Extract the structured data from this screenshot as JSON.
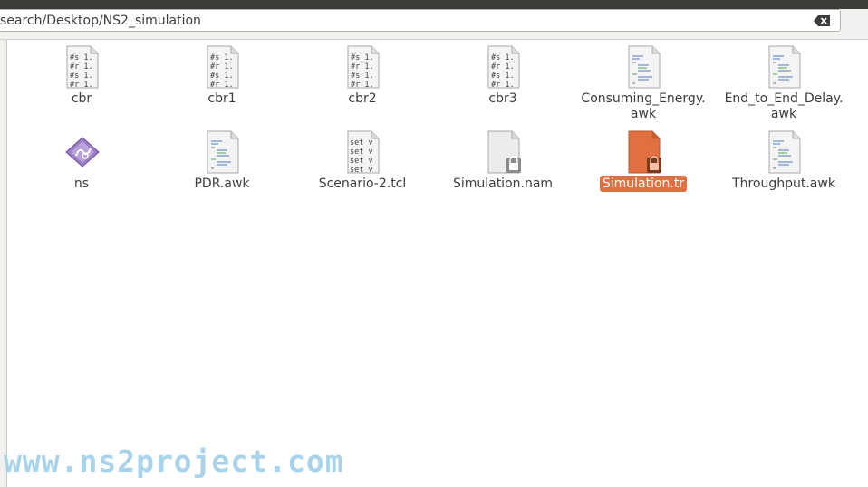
{
  "location_bar": {
    "path": "search/Desktop/NS2_simulation"
  },
  "files": [
    {
      "name": "cbr",
      "type": "text-preview",
      "preview": [
        "#s 1.",
        "#r 1.",
        "#s 1.",
        "#r 1."
      ]
    },
    {
      "name": "cbr1",
      "type": "text-preview",
      "preview": [
        "#s 1.",
        "#r 1.",
        "#s 1.",
        "#r 1."
      ]
    },
    {
      "name": "cbr2",
      "type": "text-preview",
      "preview": [
        "#s 1.",
        "#r 1.",
        "#s 1.",
        "#r 1."
      ]
    },
    {
      "name": "cbr3",
      "type": "text-preview",
      "preview": [
        "#s 1.",
        "#r 1.",
        "#s 1.",
        "#r 1."
      ]
    },
    {
      "name_line1": "Consuming_Energy.",
      "name_line2": "awk",
      "type": "code-lines"
    },
    {
      "name_line1": "End_to_End_Delay.",
      "name_line2": "awk",
      "type": "code-lines"
    },
    {
      "name": "ns",
      "type": "executable"
    },
    {
      "name": "PDR.awk",
      "type": "code-lines"
    },
    {
      "name": "Scenario-2.tcl",
      "type": "text-preview",
      "preview": [
        "set v",
        "set v",
        "set v",
        "set v"
      ]
    },
    {
      "name": "Simulation.nam",
      "type": "locked"
    },
    {
      "name": "Simulation.tr",
      "type": "locked-selected",
      "selected": true
    },
    {
      "name": "Throughput.awk",
      "type": "code-lines"
    }
  ],
  "watermark": "www.ns2project.com",
  "colors": {
    "selection": "#e0703f",
    "titlebar": "#3c3b37",
    "watermark": "#a9d3ea"
  }
}
